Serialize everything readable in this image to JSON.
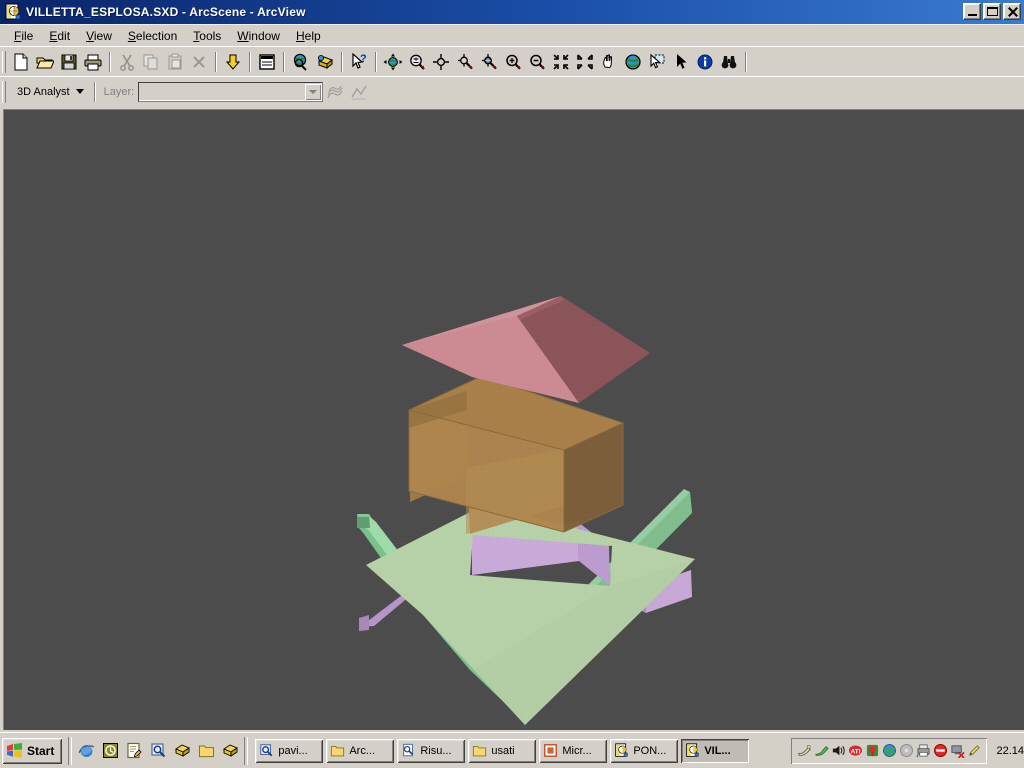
{
  "window": {
    "title": "VILLETTA_ESPLOSA.SXD - ArcScene - ArcView",
    "app_icon": "arcscene-document-icon",
    "buttons": {
      "minimize": "Minimize",
      "maximize": "Maximize",
      "close": "Close"
    }
  },
  "menubar": {
    "items": [
      {
        "label": "File",
        "mnemonic": "F"
      },
      {
        "label": "Edit",
        "mnemonic": "E"
      },
      {
        "label": "View",
        "mnemonic": "V"
      },
      {
        "label": "Selection",
        "mnemonic": "S"
      },
      {
        "label": "Tools",
        "mnemonic": "T"
      },
      {
        "label": "Window",
        "mnemonic": "W"
      },
      {
        "label": "Help",
        "mnemonic": "H"
      }
    ]
  },
  "standard_toolbar": {
    "name": "Standard",
    "buttons": [
      {
        "icon": "new-document-icon",
        "tooltip": "New Scene",
        "enabled": true
      },
      {
        "icon": "open-folder-icon",
        "tooltip": "Open",
        "enabled": true
      },
      {
        "icon": "save-floppy-icon",
        "tooltip": "Save",
        "enabled": true
      },
      {
        "icon": "print-icon",
        "tooltip": "Print",
        "enabled": true
      },
      {
        "icon": "cut-scissors-icon",
        "tooltip": "Cut",
        "enabled": false
      },
      {
        "icon": "copy-icon",
        "tooltip": "Copy",
        "enabled": false
      },
      {
        "icon": "paste-icon",
        "tooltip": "Paste",
        "enabled": false
      },
      {
        "icon": "delete-x-icon",
        "tooltip": "Delete",
        "enabled": false
      },
      {
        "icon": "add-data-icon",
        "tooltip": "Add Data",
        "enabled": true
      },
      {
        "icon": "scene-properties-icon",
        "tooltip": "Scene Properties",
        "enabled": true
      },
      {
        "icon": "globe-search-icon",
        "tooltip": "ArcCatalog",
        "enabled": true
      },
      {
        "icon": "arctoolbox-icon",
        "tooltip": "ArcToolbox",
        "enabled": true
      },
      {
        "icon": "whats-this-icon",
        "tooltip": "What's This?",
        "enabled": true
      }
    ]
  },
  "tools_toolbar": {
    "name": "Tools",
    "buttons": [
      {
        "icon": "navigate-globe-icon",
        "tooltip": "Navigate",
        "enabled": true
      },
      {
        "icon": "fly-zoom-icon",
        "tooltip": "Fly",
        "enabled": true
      },
      {
        "icon": "center-on-target-icon",
        "tooltip": "Center on Target",
        "enabled": true
      },
      {
        "icon": "zoom-to-target-icon",
        "tooltip": "Zoom to Target",
        "enabled": true
      },
      {
        "icon": "set-observer-icon",
        "tooltip": "Set Observer",
        "enabled": true
      },
      {
        "icon": "zoom-in-icon",
        "tooltip": "Zoom In",
        "enabled": true
      },
      {
        "icon": "zoom-out-icon",
        "tooltip": "Zoom Out",
        "enabled": true
      },
      {
        "icon": "zoom-in-fixed-icon",
        "tooltip": "Zoom In Fixed",
        "enabled": true
      },
      {
        "icon": "zoom-out-fixed-icon",
        "tooltip": "Zoom Out Fixed",
        "enabled": true
      },
      {
        "icon": "pan-hand-icon",
        "tooltip": "Pan",
        "enabled": true
      },
      {
        "icon": "full-extent-globe-icon",
        "tooltip": "Full Extent",
        "enabled": true
      },
      {
        "icon": "select-features-icon",
        "tooltip": "Select Features",
        "enabled": true
      },
      {
        "icon": "select-arrow-icon",
        "tooltip": "Select Elements",
        "enabled": true
      },
      {
        "icon": "identify-info-icon",
        "tooltip": "Identify",
        "enabled": true
      },
      {
        "icon": "find-binoculars-icon",
        "tooltip": "Find",
        "enabled": true
      }
    ]
  },
  "analyst_toolbar": {
    "menu_label": "3D Analyst",
    "layer_label": "Layer:",
    "layer_value": "",
    "layer_placeholder": "",
    "buttons": [
      {
        "icon": "create-contour-icon",
        "tooltip": "Create/Modify TIN",
        "enabled": false
      },
      {
        "icon": "interpolate-line-icon",
        "tooltip": "Interpolate Line",
        "enabled": false
      }
    ]
  },
  "scene": {
    "name": "3d-scene-view",
    "background_color": "#4b4b4b",
    "model_title": "Exploded view of a house (villetta)",
    "layers": [
      {
        "name": "roof-light-face",
        "label": "Roof (sunlit slope)",
        "color": "#cd8b92"
      },
      {
        "name": "roof-dark-face",
        "label": "Roof (shaded slope)",
        "color": "#8b5458"
      },
      {
        "name": "roof-edge-face",
        "label": "Roof (hip face)",
        "color": "#b87b84"
      },
      {
        "name": "walls-top-face",
        "label": "Walls (top)",
        "color": "#b08a52"
      },
      {
        "name": "walls-front-face",
        "label": "Walls (front)",
        "color": "#a9803f"
      },
      {
        "name": "walls-side-face",
        "label": "Walls (side)",
        "color": "#7d5f38"
      },
      {
        "name": "walls-interior",
        "label": "Walls (interior)",
        "color": "#9a7647"
      },
      {
        "name": "floor-slab",
        "label": "Floor slab",
        "color": "#b5d1a6"
      },
      {
        "name": "partition-walls",
        "label": "Partition walls",
        "color": "#c9a8d8"
      },
      {
        "name": "terrain-top",
        "label": "Terrain (surface)",
        "color": "#8ec495"
      },
      {
        "name": "terrain-edge",
        "label": "Terrain (edge)",
        "color": "#a8e0ab"
      },
      {
        "name": "terrain-side",
        "label": "Terrain (side)",
        "color": "#6fae80"
      }
    ]
  },
  "taskbar": {
    "start_label": "Start",
    "quicklaunch": [
      {
        "icon": "internet-explorer-icon",
        "tooltip": "Internet Explorer"
      },
      {
        "icon": "show-desktop-icon",
        "tooltip": "Show Desktop"
      },
      {
        "icon": "notepad-icon",
        "tooltip": "Notepad"
      },
      {
        "icon": "search-folder-icon",
        "tooltip": "Search"
      },
      {
        "icon": "arcmap-doc-icon",
        "tooltip": "ArcMap"
      },
      {
        "icon": "folder-icon",
        "tooltip": "Folder"
      },
      {
        "icon": "arcscene-doc-icon",
        "tooltip": "ArcScene"
      }
    ],
    "tasks": [
      {
        "label": "pavi...",
        "icon": "search-folder-icon",
        "active": false
      },
      {
        "label": "Arc...",
        "icon": "folder-icon",
        "active": false
      },
      {
        "label": "Risu...",
        "icon": "document-icon",
        "active": false
      },
      {
        "label": "usati",
        "icon": "folder-icon",
        "active": false
      },
      {
        "label": "Micr...",
        "icon": "powerpoint-icon",
        "active": false
      },
      {
        "label": "PON...",
        "icon": "arcscene-doc-icon",
        "active": false
      },
      {
        "label": "VIL...",
        "icon": "arcscene-doc-icon",
        "active": true
      }
    ],
    "tray": [
      {
        "icon": "plug-icon"
      },
      {
        "icon": "network-cable-icon"
      },
      {
        "icon": "volume-speaker-icon"
      },
      {
        "icon": "ati-display-icon"
      },
      {
        "icon": "red-balloon-icon"
      },
      {
        "icon": "globe-green-icon"
      },
      {
        "icon": "grey-disc-icon"
      },
      {
        "icon": "printer-network-icon"
      },
      {
        "icon": "no-entry-icon"
      },
      {
        "icon": "monitor-disconnect-icon"
      },
      {
        "icon": "pencil-yellow-icon"
      }
    ],
    "clock": "22.14"
  }
}
